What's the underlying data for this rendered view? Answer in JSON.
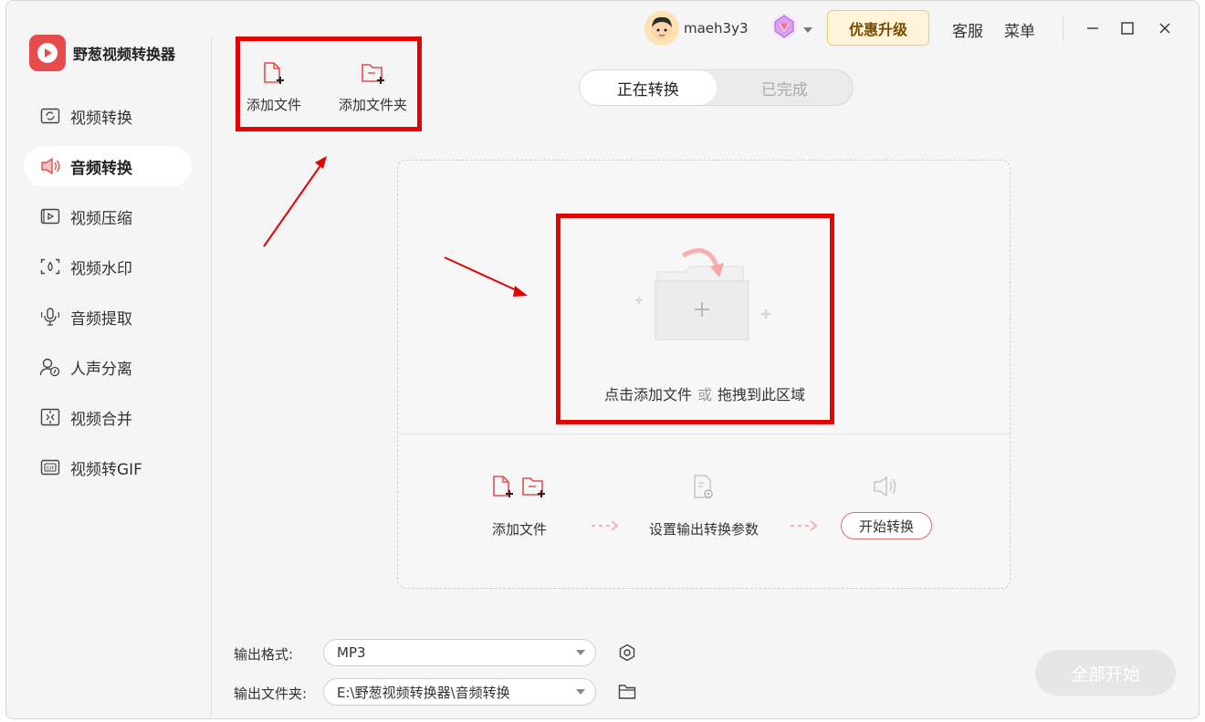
{
  "app": {
    "name": "野葱视频转换器"
  },
  "sidebar": {
    "items": [
      {
        "label": "视频转换",
        "icon": "video-convert-icon",
        "active": false
      },
      {
        "label": "音频转换",
        "icon": "audio-convert-icon",
        "active": true
      },
      {
        "label": "视频压缩",
        "icon": "video-compress-icon",
        "active": false
      },
      {
        "label": "视频水印",
        "icon": "video-watermark-icon",
        "active": false
      },
      {
        "label": "音频提取",
        "icon": "audio-extract-icon",
        "active": false
      },
      {
        "label": "人声分离",
        "icon": "vocal-separate-icon",
        "active": false
      },
      {
        "label": "视频合并",
        "icon": "video-merge-icon",
        "active": false
      },
      {
        "label": "视频转GIF",
        "icon": "video-to-gif-icon",
        "active": false
      }
    ]
  },
  "header": {
    "username": "maeh3y3",
    "upgrade_label": "优惠升级",
    "support_label": "客服",
    "menu_label": "菜单"
  },
  "toolbar": {
    "add_file_label": "添加文件",
    "add_folder_label": "添加文件夹"
  },
  "tabs": [
    {
      "label": "正在转换",
      "active": true
    },
    {
      "label": "已完成",
      "active": false
    }
  ],
  "dropzone": {
    "hint_main": "点击添加文件",
    "hint_or": "或",
    "hint_drag": "拖拽到此区域"
  },
  "steps": {
    "add_file": "添加文件",
    "set_params": "设置输出转换参数",
    "start": "开始转换"
  },
  "output": {
    "format_label": "输出格式:",
    "format_value": "MP3",
    "folder_label": "输出文件夹:",
    "folder_value": "E:\\野葱视频转换器\\音频转换"
  },
  "start_all_label": "全部开始",
  "colors": {
    "accent": "#e84b4b",
    "annotation": "#e60000",
    "upgrade_bg": "#fff4d9"
  }
}
